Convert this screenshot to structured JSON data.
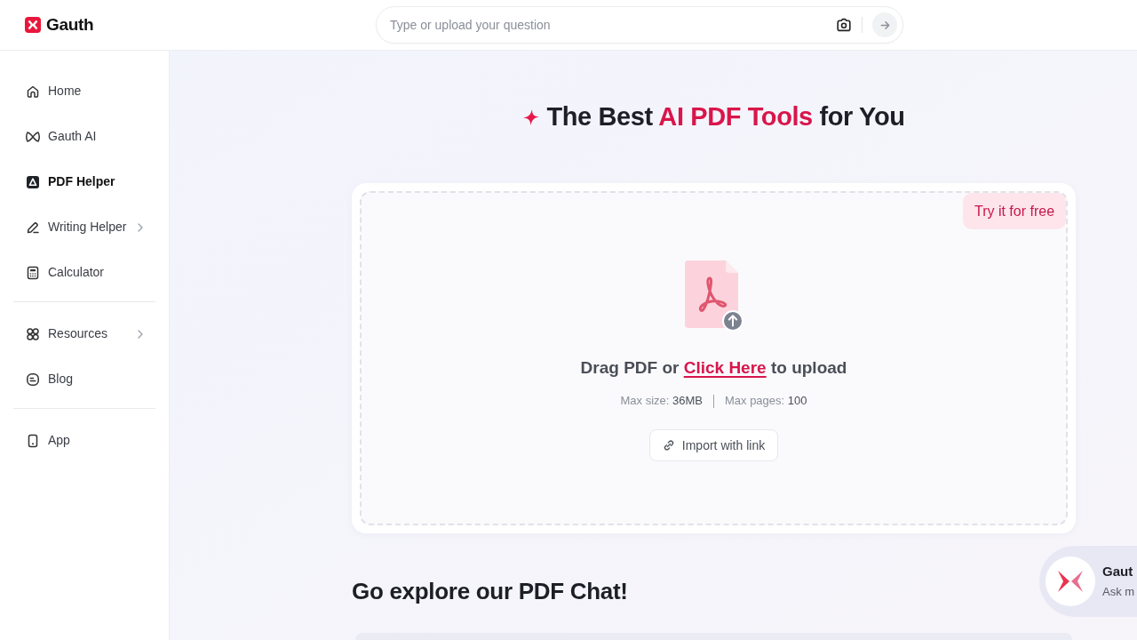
{
  "header": {
    "logo": {
      "name": "Gauth"
    },
    "search": {
      "placeholder": "Type or upload your question"
    }
  },
  "sidebar": {
    "groups": [
      {
        "items": [
          {
            "label": "Home",
            "kind": "link",
            "selected": false
          },
          {
            "label": "Gauth AI",
            "kind": "link",
            "selected": false
          },
          {
            "label": "PDF Helper",
            "kind": "link",
            "selected": true
          },
          {
            "label": "Writing Helper",
            "kind": "submenu",
            "selected": false
          },
          {
            "label": "Calculator",
            "kind": "link",
            "selected": false
          }
        ]
      },
      {
        "items": [
          {
            "label": "Resources",
            "kind": "submenu",
            "selected": false
          },
          {
            "label": "Blog",
            "kind": "link",
            "selected": false
          }
        ]
      },
      {
        "items": [
          {
            "label": "App",
            "kind": "link",
            "selected": false
          }
        ]
      }
    ]
  },
  "hero": {
    "title": {
      "before": "The Best ",
      "highlight": "AI PDF Tools",
      "after": " for You"
    }
  },
  "upload": {
    "badge": "Try it for free",
    "prompt": {
      "before": "Drag PDF or ",
      "link": "Click Here",
      "after": " to upload"
    },
    "limits": [
      {
        "label": "Max size:",
        "value": "36MB"
      },
      {
        "label": "Max pages:",
        "value": "100"
      }
    ],
    "import_button": "Import with link"
  },
  "pdf_chat": {
    "heading": "Go explore our PDF Chat!"
  },
  "assistant_widget": {
    "title": "Gaut",
    "subtitle": "Ask m"
  }
}
